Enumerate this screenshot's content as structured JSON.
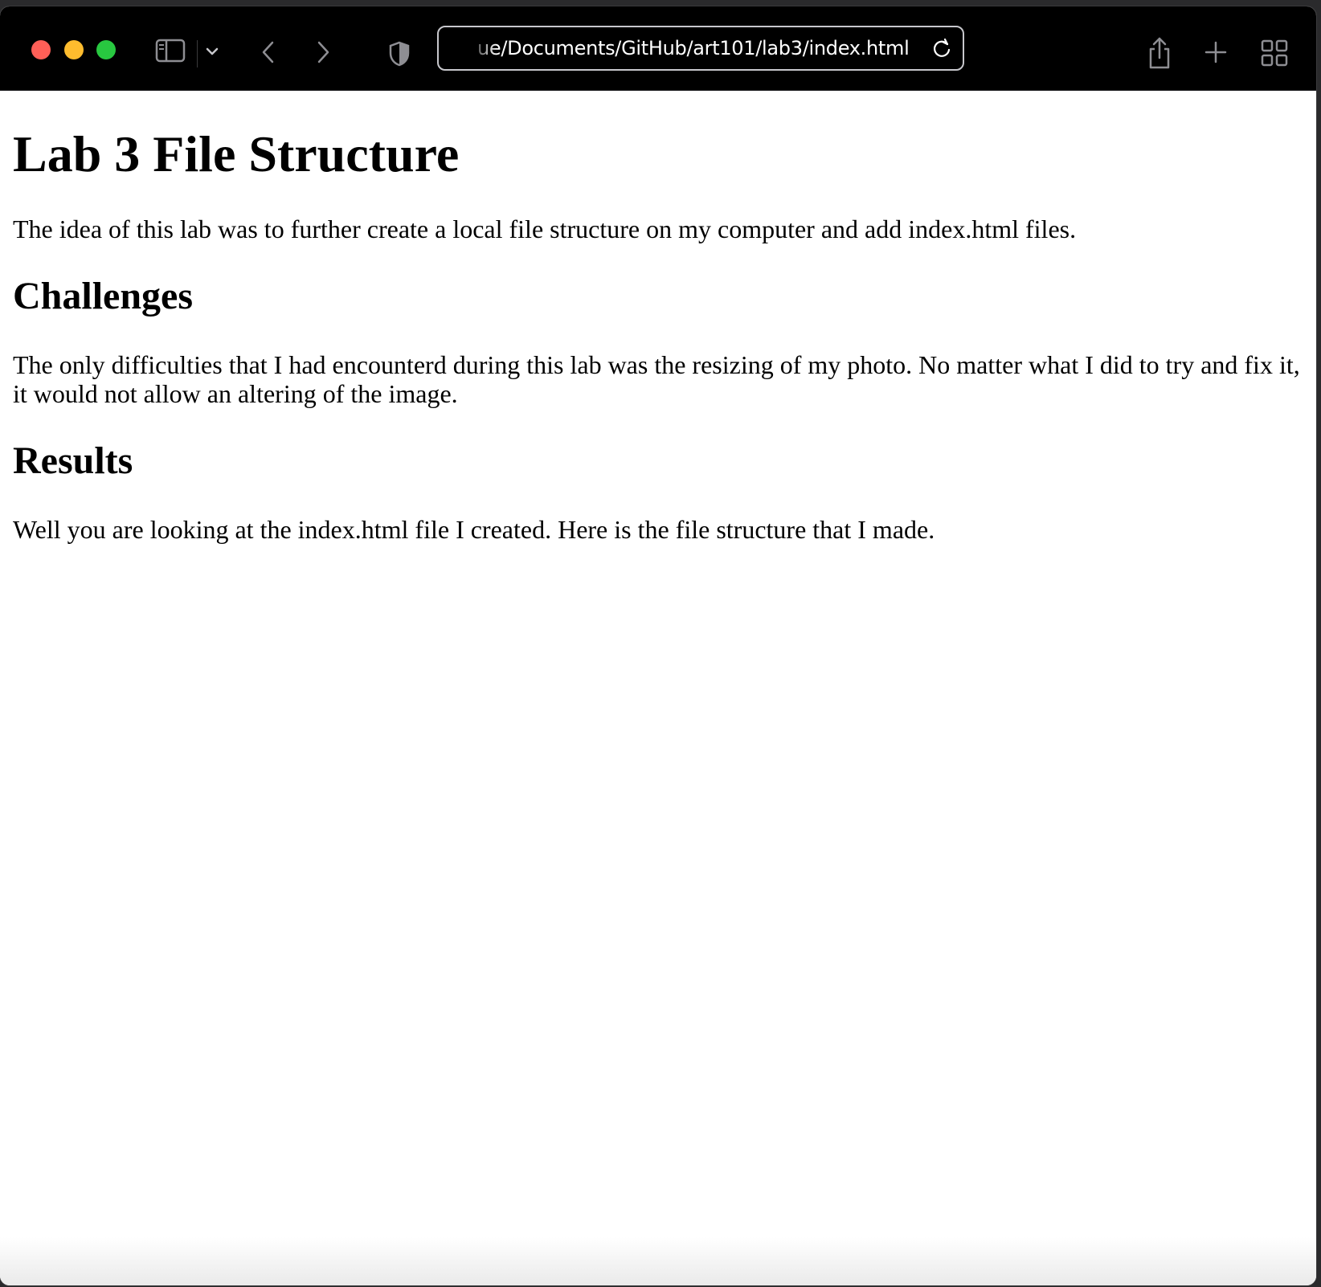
{
  "browser": {
    "url": "ue/Documents/GitHub/art101/lab3/index.html"
  },
  "page": {
    "title": "Lab 3 File Structure",
    "intro": "The idea of this lab was to further create a local file structure on my computer and add index.html files.",
    "challenges_heading": "Challenges",
    "challenges_text": "The only difficulties that I had encounterd during this lab was the resizing of my photo. No matter what I did to try and fix it, it would not allow an altering of the image.",
    "results_heading": "Results",
    "results_text": "Well you are looking at the index.html file I created. Here is the file structure that I made."
  },
  "colors": {
    "toolbar_bg": "#000000",
    "close": "#ff5f57",
    "minimize": "#febc2e",
    "maximize": "#28c840"
  },
  "icons": [
    "sidebar-toggle-icon",
    "chevron-down-icon",
    "back-icon",
    "forward-icon",
    "privacy-shield-icon",
    "reload-icon",
    "share-icon",
    "new-tab-icon",
    "tab-overview-icon"
  ]
}
